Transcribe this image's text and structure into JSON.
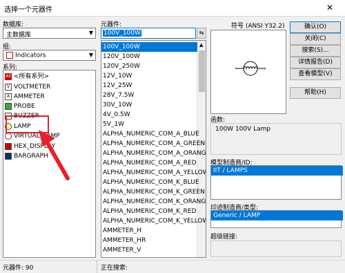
{
  "window": {
    "title": "选择一个元器件",
    "close_glyph": "✕"
  },
  "left": {
    "database_label": "数据库:",
    "database_value": "主数据库",
    "group_label": "组:",
    "group_value": "Indicators",
    "family_label": "系列:",
    "families": [
      {
        "label": "<所有系列>",
        "icon": "all-families-icon"
      },
      {
        "label": "VOLTMETER",
        "icon": "voltmeter-icon"
      },
      {
        "label": "AMMETER",
        "icon": "ammeter-icon"
      },
      {
        "label": "PROBE",
        "icon": "probe-icon"
      },
      {
        "label": "BUZZER",
        "icon": "buzzer-icon"
      },
      {
        "label": "LAMP",
        "icon": "lamp-icon"
      },
      {
        "label": "VIRTUAL_LAMP",
        "icon": "virtual-lamp-icon"
      },
      {
        "label": "HEX_DISPLAY",
        "icon": "hex-display-icon"
      },
      {
        "label": "BARGRAPH",
        "icon": "bargraph-icon"
      }
    ]
  },
  "middle": {
    "component_label": "元器件:",
    "search_value": "100V_100W",
    "filter_icon": "filter-icon",
    "components": [
      "100V_100W",
      "120V_100W",
      "120V_250W",
      "12V_10W",
      "12V_25W",
      "28V_7.5W",
      "30V_10W",
      "4V_0.5W",
      "5V_1W",
      "ALPHA_NUMERIC_COM_A_BLUE",
      "ALPHA_NUMERIC_COM_A_GREEN",
      "ALPHA_NUMERIC_COM_A_ORANGE",
      "ALPHA_NUMERIC_COM_A_RED",
      "ALPHA_NUMERIC_COM_A_YELLOW",
      "ALPHA_NUMERIC_COM_K_BLUE",
      "ALPHA_NUMERIC_COM_K_GREEN",
      "ALPHA_NUMERIC_COM_K_ORANGE",
      "ALPHA_NUMERIC_COM_K_RED",
      "ALPHA_NUMERIC_COM_K_YELLOW",
      "AMMETER_H",
      "AMMETER_HR",
      "AMMETER_V"
    ]
  },
  "right": {
    "symbol_label": "符号 (ANSI Y32.2)",
    "function_label": "函数:",
    "function_value": "100W 100V Lamp",
    "model_label": "模型制造商/ID:",
    "model_value": "IIT / LAMPS",
    "footprint_label": "印迹制造商/类型:",
    "footprint_value": "Generic / LAMP",
    "hyperlink_label": "超级链接:"
  },
  "buttons": {
    "ok": "确认(O)",
    "close": "关闭(C)",
    "search": "搜索(S)...",
    "detail": "详情报告(D)",
    "view_model": "查看模型(V)",
    "help": "帮助(H)"
  },
  "status": {
    "components_count": "元器件: 90",
    "searching": "正在搜索:"
  },
  "colors": {
    "selection": "#0078d7",
    "annotation": "#e8202a"
  }
}
